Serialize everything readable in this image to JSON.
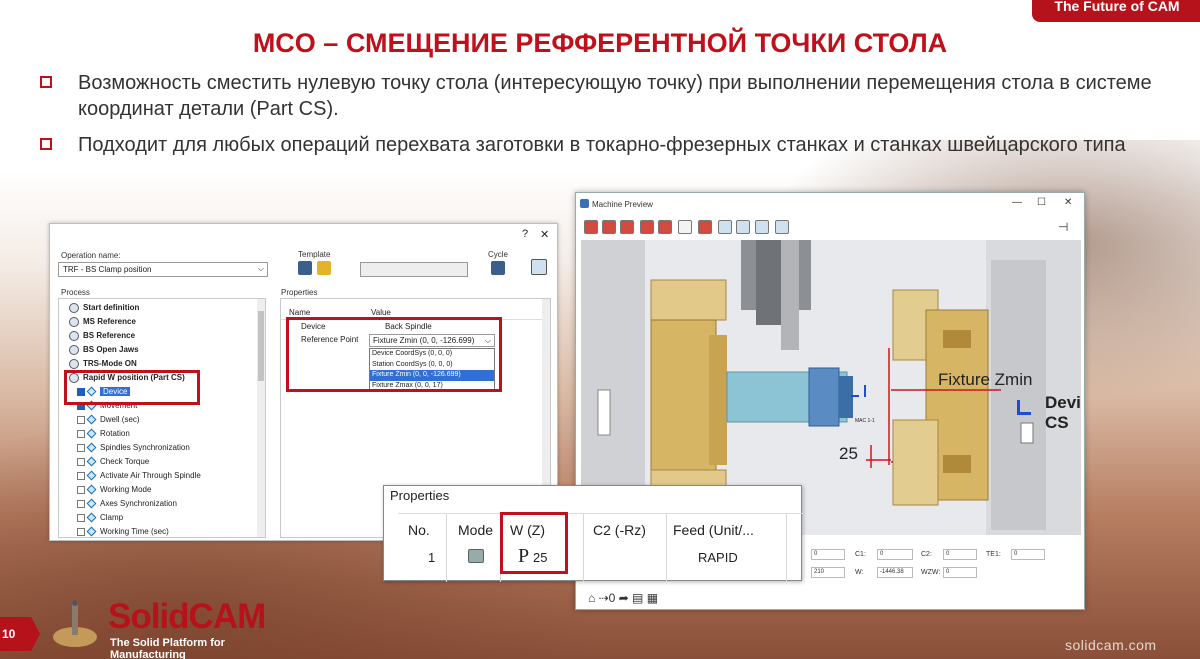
{
  "brand": {
    "tab_text": "The Future of CAM",
    "logo_name": "SolidCAM",
    "logo_tagline": "The Solid Platform for Manufacturing",
    "footer_url": "solidcam.com",
    "page_number": "10",
    "accent_color": "#c0101a"
  },
  "slide": {
    "title": "MCO – СМЕЩЕНИЕ РЕФФЕРЕНТНОЙ ТОЧКИ СТОЛА",
    "bullets": [
      "Возможность сместить нулевую точку стола (интересующую точку) при выполнении перемещения стола в системе координат детали (Part CS).",
      "Подходит для любых операций перехвата заготовки в токарно-фрезерных станках и станках швейцарского типа"
    ]
  },
  "operation_dialog": {
    "help_icon": "?",
    "close_icon": "✕",
    "operation_name_label": "Operation name:",
    "operation_name_value": "TRF - BS Clamp position",
    "template_label": "Template",
    "cycle_label": "Cycle",
    "process_label": "Process",
    "properties_label": "Properties",
    "tree": [
      {
        "label": "Start definition",
        "bold": true,
        "icon": "globe"
      },
      {
        "label": "MS Reference",
        "bold": true,
        "icon": "globe"
      },
      {
        "label": "BS Reference",
        "bold": true,
        "icon": "globe"
      },
      {
        "label": "BS Open Jaws",
        "bold": true,
        "icon": "globe"
      },
      {
        "label": "TRS-Mode ON",
        "bold": true,
        "icon": "globe"
      },
      {
        "label": "Rapid W position (Part CS)",
        "bold": true,
        "icon": "globe"
      },
      {
        "label": "Device",
        "checked": true,
        "selected": true
      },
      {
        "label": "Movement",
        "checked": true
      },
      {
        "label": "Dwell (sec)"
      },
      {
        "label": "Rotation"
      },
      {
        "label": "Spindles Synchronization"
      },
      {
        "label": "Check Torque"
      },
      {
        "label": "Activate Air Through Spindle"
      },
      {
        "label": "Working Mode"
      },
      {
        "label": "Axes Synchronization"
      },
      {
        "label": "Clamp"
      },
      {
        "label": "Working Time (sec)"
      }
    ],
    "props_headers": {
      "name": "Name",
      "value": "Value"
    },
    "props_rows": [
      {
        "name": "Device",
        "value": "Back Spindle"
      },
      {
        "name": "Reference Point",
        "value": "Fixture Zmin (0, 0, -126.699)"
      }
    ],
    "dropdown_options": [
      "Device CoordSys (0, 0, 0)",
      "Station CoordSys (0, 0, 0)",
      "Fixture Zmin (0, 0, -126.699)",
      "Fixture Zmax (0, 0, 17)"
    ],
    "dropdown_selected_index": 2
  },
  "machine_preview": {
    "title": "Machine Preview",
    "min_btn": "—",
    "max_btn": "☐",
    "close_btn": "✕",
    "pin_icon": "⊣",
    "annotations": {
      "fixture": "Fixture Zmin",
      "device_cs": "Device CS",
      "offset": "25",
      "mac": "MAC 1-1"
    },
    "status_fields": [
      {
        "label": "",
        "value": "0"
      },
      {
        "label": "C1:",
        "value": "0"
      },
      {
        "label": "C2:",
        "value": "0"
      },
      {
        "label": "TE1:",
        "value": "0"
      },
      {
        "label": "",
        "value": "210"
      },
      {
        "label": "W:",
        "value": "-1446.38"
      },
      {
        "label": "WZW:",
        "value": "0"
      }
    ],
    "bottom_toolbar": "⌂ ⇢0 ➦ ▤ ▦"
  },
  "properties_popup": {
    "title": "Properties",
    "headers": [
      "No.",
      "Mode",
      "W (Z)",
      "C2 (-Rz)",
      "Feed (Unit/..."
    ],
    "row": {
      "no": "1",
      "mode_icon": "pencil-icon",
      "w_prefix": "P",
      "w_value": "25",
      "c2": "",
      "feed": "RAPID"
    }
  }
}
